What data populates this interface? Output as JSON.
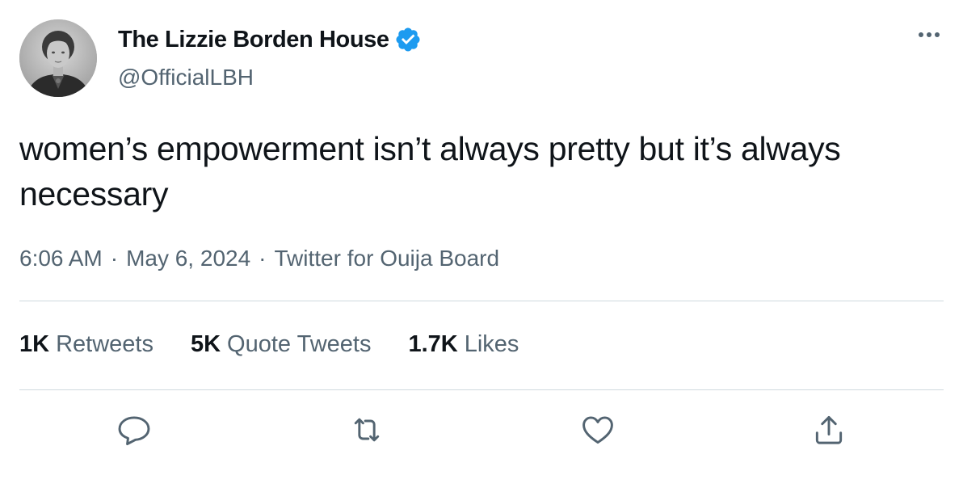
{
  "author": {
    "display_name": "The Lizzie Borden House",
    "handle": "@OfficialLBH",
    "verified": true,
    "verified_color": "#1d9bf0"
  },
  "tweet": {
    "text": "women’s empowerment isn’t always pretty but it’s always necessary",
    "time": "6:06 AM",
    "date": "May 6, 2024",
    "source": "Twitter for Ouija Board",
    "separator": "·"
  },
  "stats": {
    "retweets": {
      "count": "1K",
      "label": "Retweets"
    },
    "quotes": {
      "count": "5K",
      "label": "Quote Tweets"
    },
    "likes": {
      "count": "1.7K",
      "label": "Likes"
    }
  },
  "actions": [
    "reply-icon",
    "retweet-icon",
    "like-icon",
    "share-icon"
  ],
  "colors": {
    "text_primary": "#0f1419",
    "text_secondary": "#536471",
    "divider": "#cfd9de"
  }
}
